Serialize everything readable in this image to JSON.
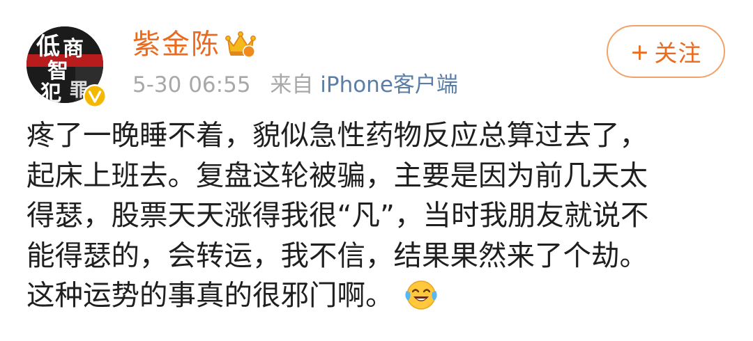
{
  "user": {
    "name": "紫金陈",
    "avatar_icon": "book-cover-avatar",
    "avatar_text": [
      "低",
      "智",
      "商",
      "犯",
      "罪"
    ],
    "verified_icon": "verified-v-badge",
    "vip_icon": "crown-icon"
  },
  "meta": {
    "time": "5-30 06:55",
    "source_prefix": "来自",
    "source_name": "iPhone客户端"
  },
  "follow": {
    "plus": "+",
    "label": "关注"
  },
  "post": {
    "lines": [
      "疼了一晚睡不着，貌似急性药物反应总算过去了，",
      "起床上班去。复盘这轮被骗，主要是因为前几天太",
      "得瑟，股票天天涨得我很“凡”，当时我朋友就说不",
      "能得瑟的，会转运，我不信，结果果然来了个劫。",
      "这种运势的事真的很邪门啊。"
    ],
    "emoji_icon": "laughing-tears-emoji"
  },
  "colors": {
    "accent": "#ea6a1e",
    "link": "#5a7ea6",
    "meta_gray": "#a8a8a8",
    "text": "#1f1f1f",
    "badge_yellow": "#f5b800"
  }
}
